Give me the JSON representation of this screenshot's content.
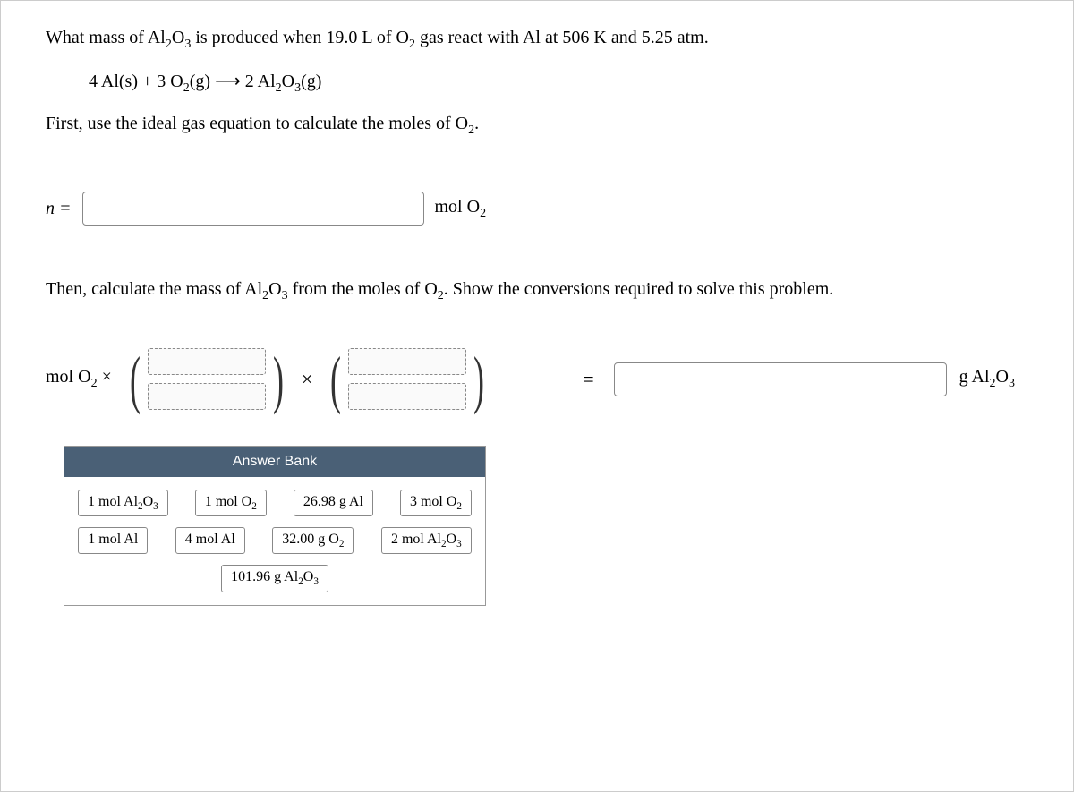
{
  "question": {
    "prefix": "What mass of Al",
    "sub1": "2",
    "mid1": "O",
    "sub2": "3",
    "mid2": " is produced when 19.0 L of O",
    "sub3": "2",
    "suffix": " gas react with Al at 506 K and 5.25 atm."
  },
  "reaction": {
    "l1": "4 Al(s) + 3 O",
    "l1sub": "2",
    "l2": "(g) ",
    "arrow": "⟶",
    "r1": " 2 Al",
    "r1sub": "2",
    "r2": "O",
    "r2sub": "3",
    "r3": "(g)"
  },
  "instruction1": {
    "pre": "First, use the ideal gas equation to calculate the moles of O",
    "sub": "2",
    "post": "."
  },
  "nrow": {
    "n": "n",
    "eq": " =",
    "unit_pre": "mol O",
    "unit_sub": "2"
  },
  "instruction2": {
    "pre": "Then, calculate the mass of Al",
    "s1": "2",
    "m1": "O",
    "s2": "3",
    "m2": " from the moles of O",
    "s3": "2",
    "post": ". Show the conversions required to solve this problem."
  },
  "conv": {
    "lead_pre": "mol O",
    "lead_sub": "2",
    "lead_post": " ×",
    "times": "×",
    "equals": "=",
    "result_pre": "g Al",
    "result_s1": "2",
    "result_m": "O",
    "result_s2": "3"
  },
  "answer_bank": {
    "title": "Answer Bank",
    "tiles": [
      {
        "t": "1 mol Al",
        "s1": "2",
        "t2": "O",
        "s2": "3"
      },
      {
        "t": "1 mol O",
        "s1": "2"
      },
      {
        "t": "26.98 g Al"
      },
      {
        "t": "3 mol O",
        "s1": "2"
      },
      {
        "t": "1 mol Al"
      },
      {
        "t": "4 mol Al"
      },
      {
        "t": "32.00 g O",
        "s1": "2"
      },
      {
        "t": "2 mol Al",
        "s1": "2",
        "t2": "O",
        "s2": "3"
      },
      {
        "t": "101.96 g Al",
        "s1": "2",
        "t2": "O",
        "s2": "3"
      }
    ]
  }
}
